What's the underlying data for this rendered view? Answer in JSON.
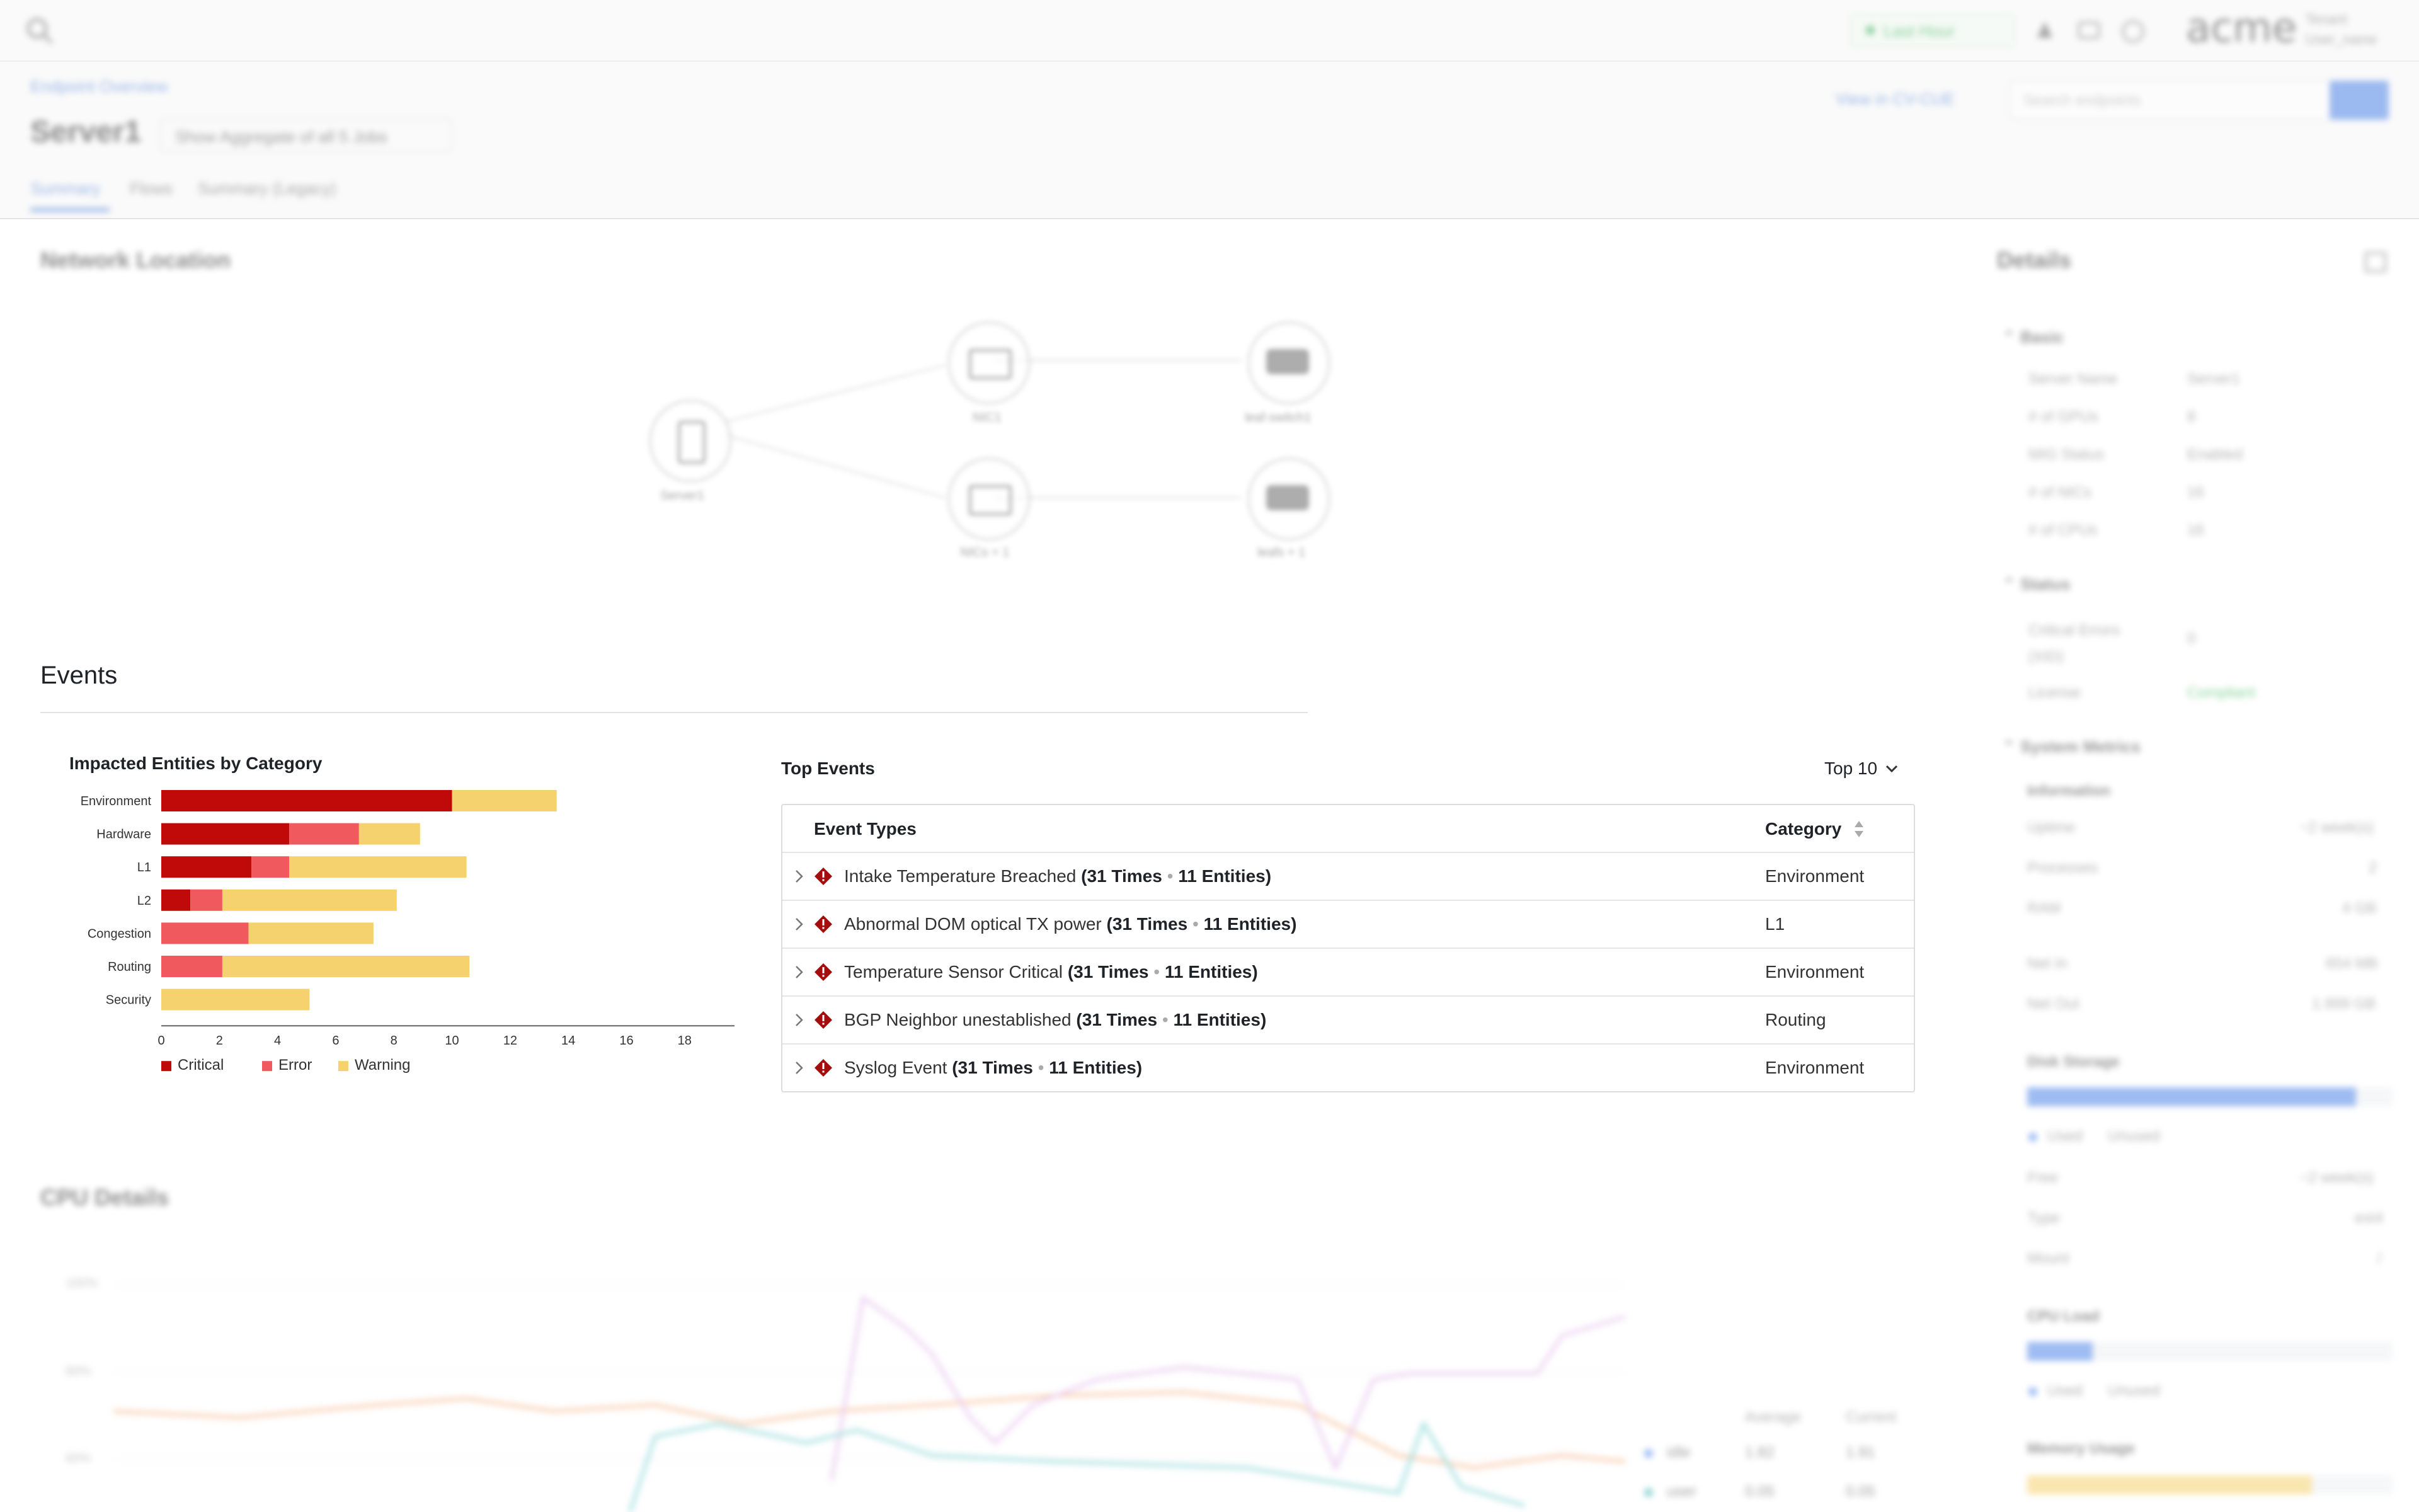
{
  "topbar": {
    "time_range": "Last Hour",
    "logo": "acme",
    "tenant_label": "Tenant",
    "user_name": "User_name"
  },
  "header": {
    "breadcrumb": "Endpoint Overview",
    "title": "Server1",
    "aggregate_select": "Show Aggregate of all 5 Jobs",
    "view_link": "View in CV-CUE",
    "search_placeholder": "Search endpoints",
    "tabs": [
      "Summary",
      "Flows",
      "Summary (Legacy)"
    ]
  },
  "network": {
    "title": "Network Location",
    "nodes": [
      "Server1",
      "NIC1",
      "leaf-switch1",
      "NICs + 1",
      "leafs + 1"
    ]
  },
  "events": {
    "title": "Events",
    "impacted": {
      "title": "Impacted Entities by Category"
    },
    "top": {
      "title": "Top Events",
      "select_label": "Top 10",
      "col_event": "Event Types",
      "col_category": "Category",
      "rows": [
        {
          "name": "Intake Temperature Breached",
          "count": "(31 Times",
          "entities": "11 Entities)",
          "category": "Environment"
        },
        {
          "name": "Abnormal DOM optical TX power",
          "count": "(31 Times",
          "entities": "11 Entities)",
          "category": "L1"
        },
        {
          "name": "Temperature Sensor Critical",
          "count": "(31 Times",
          "entities": "11 Entities)",
          "category": "Environment"
        },
        {
          "name": "BGP Neighbor unestablished",
          "count": "(31 Times",
          "entities": "11 Entities)",
          "category": "Routing"
        },
        {
          "name": "Syslog Event",
          "count": "(31 Times",
          "entities": "11 Entities)",
          "category": "Environment"
        }
      ]
    }
  },
  "cpu": {
    "title": "CPU Details",
    "y_ticks": [
      "100%",
      "80%",
      "60%"
    ],
    "legend_header": [
      "Average",
      "Current"
    ],
    "legend": [
      {
        "name": "idle",
        "avg": "1.82",
        "cur": "1.91",
        "color": "#4f86e8"
      },
      {
        "name": "user",
        "avg": "0.05",
        "cur": "0.05",
        "color": "#3bb3b3"
      }
    ]
  },
  "details": {
    "title": "Details",
    "basic": {
      "title": "Basic",
      "rows": [
        {
          "k": "Server Name",
          "v": "Server1"
        },
        {
          "k": "# of GPUs",
          "v": "8"
        },
        {
          "k": "MIG Status",
          "v": "Enabled"
        },
        {
          "k": "# of NICs",
          "v": "16"
        },
        {
          "k": "# of CPUs",
          "v": "16"
        }
      ]
    },
    "status": {
      "title": "Status",
      "critical_label": "Critical Errors (XID)",
      "critical_value": "0",
      "license_label": "License",
      "license_value": "Compliant"
    },
    "metrics": {
      "title": "System Metrics",
      "info_title": "Information",
      "info_rows": [
        {
          "k": "Uptime",
          "v": "~2 week(s)"
        },
        {
          "k": "Processes",
          "v": "2"
        },
        {
          "k": "RAM",
          "v": "4 GB"
        }
      ],
      "net_rows": [
        {
          "k": "Net In",
          "v": "654 MB"
        },
        {
          "k": "Net Out",
          "v": "1.999 GB"
        }
      ],
      "disk_title": "Disk Storage",
      "disk_used_fraction": 0.9,
      "used_label": "Used",
      "unused_label": "Unused",
      "disk_rows": [
        {
          "k": "Free",
          "v": "~2 week(s)"
        },
        {
          "k": "Type",
          "v": "ext4"
        },
        {
          "k": "Mount",
          "v": "/"
        }
      ],
      "cpu_load_title": "CPU Load",
      "cpu_load_fraction": 0.18,
      "memory_title": "Memory Usage",
      "memory_fraction": 0.78
    }
  },
  "chart_data": {
    "type": "bar",
    "orientation": "horizontal",
    "stacked": true,
    "title": "Impacted Entities by Category",
    "categories": [
      "Environment",
      "Hardware",
      "L1",
      "L2",
      "Congestion",
      "Routing",
      "Security"
    ],
    "series": [
      {
        "name": "Critical",
        "color": "#c00a0a",
        "values": [
          10,
          4.4,
          3.1,
          1.0,
          0,
          0,
          0
        ]
      },
      {
        "name": "Error",
        "color": "#f05a5f",
        "values": [
          0,
          2.4,
          1.3,
          1.1,
          3.0,
          2.1,
          0
        ]
      },
      {
        "name": "Warning",
        "color": "#f5d26e",
        "values": [
          3.6,
          2.1,
          6.1,
          6.0,
          4.3,
          8.5,
          5.1
        ]
      }
    ],
    "x_ticks": [
      0,
      2,
      4,
      6,
      8,
      10,
      12,
      14,
      16,
      18
    ],
    "xlim": [
      0,
      19.5
    ],
    "legend": "bottom-left",
    "grid": false
  }
}
